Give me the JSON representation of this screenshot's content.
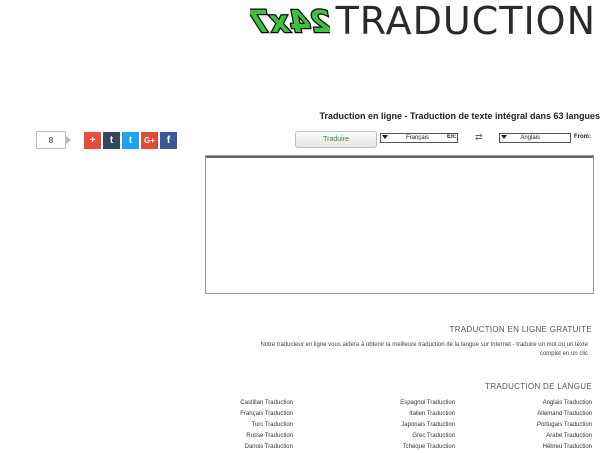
{
  "logo": {
    "badge_text": "24x7",
    "text": "TRADUCTION"
  },
  "page": {
    "heading": "Traduction en ligne - Traduction de texte intégral dans 63 langues"
  },
  "share": {
    "count": "8",
    "buttons": [
      {
        "glyph": "+",
        "color": "#e74c3c",
        "name": "share-plus-button"
      },
      {
        "glyph": "t",
        "color": "#35465c",
        "name": "share-tumblr-button"
      },
      {
        "glyph": "t",
        "color": "#1da1f2",
        "name": "share-twitter-button"
      },
      {
        "glyph": "G+",
        "color": "#dd4b39",
        "name": "share-googleplus-button"
      },
      {
        "glyph": "f",
        "color": "#3b5998",
        "name": "share-facebook-button"
      }
    ]
  },
  "translator": {
    "translate_label": "Traduire",
    "to_label": "En:",
    "to_value": "Français",
    "swap_glyph": "⇄",
    "from_label": "From:",
    "from_value": "Anglais"
  },
  "online": {
    "title": "TRADUCTION EN LIGNE GRATUITE",
    "text": "Notre traducteur en ligne vous aidera à obtenir la meilleure traduction de la langue sur Internet - traduire un mot ou un texte complet en un clic"
  },
  "languages": {
    "title": "TRADUCTION DE LANGUE",
    "col1": [
      "Anglais Traduction",
      "Allemand Traduction",
      "Portugais Traduction",
      "Arabe Traduction",
      "Hébreu Traduction"
    ],
    "col2": [
      "Espagnol Traduction",
      "Italien Traduction",
      "Japonais Traduction",
      "Grec Traduction",
      "Tchèque Traduction"
    ],
    "col3": [
      "Castillan Traduction",
      "Français Traduction",
      "Turc Traduction",
      "Russe Traduction",
      "Danois Traduction"
    ]
  }
}
